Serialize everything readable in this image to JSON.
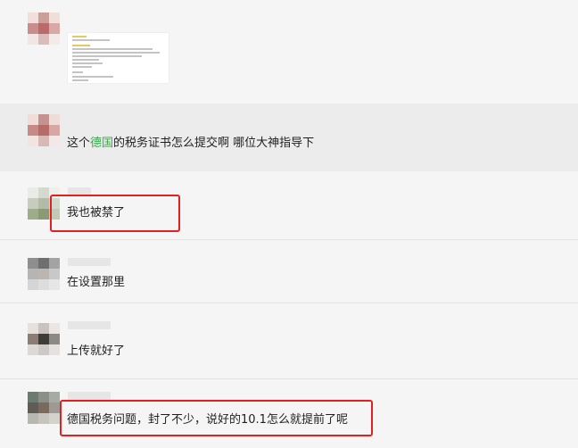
{
  "messages": [
    {
      "id": "m1",
      "type": "attachment",
      "attachment": "document-thumbnail"
    },
    {
      "id": "m2",
      "type": "text",
      "text_pre": "这个",
      "text_highlight": "德国",
      "text_post": "的税务证书怎么提交啊 哪位大神指导下"
    },
    {
      "id": "m3",
      "type": "text",
      "text": "我也被禁了"
    },
    {
      "id": "m4",
      "type": "text",
      "text": "在设置那里"
    },
    {
      "id": "m5",
      "type": "text",
      "text": "上传就好了"
    },
    {
      "id": "m6",
      "type": "text",
      "text": "德国税务问题，封了不少，说好的10.1怎么就提前了呢"
    }
  ],
  "colors": {
    "keyword_green": "#3aa64b",
    "annotation_red": "#e41f1f",
    "background": "#f5f5f5",
    "highlight_row": "#ececec"
  },
  "icons": [
    "pixelated-avatar",
    "document-thumbnail"
  ]
}
